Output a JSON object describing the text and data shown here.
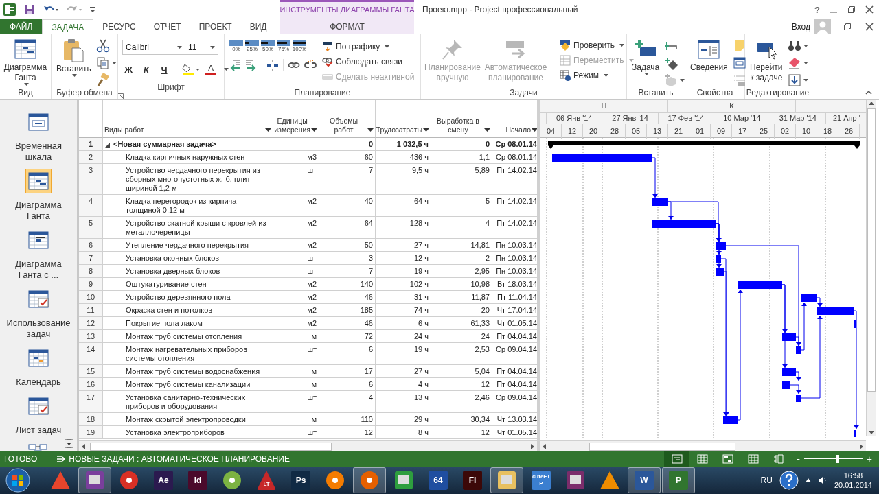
{
  "title_bar": {
    "title": "Проект.mpp - Project профессиональный",
    "context_label": "ИНСТРУМЕНТЫ ДИАГРАММЫ ГАНТА",
    "help": "?"
  },
  "tabs": [
    {
      "label": "ФАЙЛ",
      "kind": "file",
      "selected": false
    },
    {
      "label": "ЗАДАЧА",
      "kind": "tab",
      "selected": true
    },
    {
      "label": "РЕСУРС",
      "kind": "tab",
      "selected": false
    },
    {
      "label": "ОТЧЕТ",
      "kind": "tab",
      "selected": false
    },
    {
      "label": "ПРОЕКТ",
      "kind": "tab",
      "selected": false
    },
    {
      "label": "ВИД",
      "kind": "tab",
      "selected": false
    },
    {
      "label": "ФОРМАТ",
      "kind": "context",
      "selected": false
    }
  ],
  "account": {
    "label": "Вход"
  },
  "ribbon": {
    "view": {
      "label": "Вид",
      "button": {
        "label": "Диаграмма Ганта",
        "menu": true
      }
    },
    "clipboard": {
      "label": "Буфер обмена",
      "paste": {
        "label": "Вставить",
        "menu": true
      }
    },
    "font": {
      "label": "Шрифт",
      "family": "Calibri",
      "size": "11",
      "bold": "Ж",
      "italic": "К",
      "underline": "Ч",
      "font_color": "А"
    },
    "schedule": {
      "label": "Планирование",
      "percents": [
        "0%",
        "25%",
        "50%",
        "75%",
        "100%"
      ],
      "commands": [
        {
          "label": "По графику",
          "menu": true,
          "disabled": false
        },
        {
          "label": "Соблюдать связи",
          "menu": false,
          "disabled": false
        },
        {
          "label": "Сделать неактивной",
          "menu": false,
          "disabled": true
        }
      ]
    },
    "tasks": {
      "label": "Задачи",
      "modes": [
        {
          "label": "Планирование вручную",
          "disabled": true
        },
        {
          "label": "Автоматическое планирование",
          "disabled": true
        }
      ],
      "commands": [
        {
          "label": "Проверить",
          "menu": true,
          "disabled": false
        },
        {
          "label": "Переместить",
          "menu": true,
          "disabled": true
        },
        {
          "label": "Режим",
          "menu": true,
          "disabled": false
        }
      ]
    },
    "insert": {
      "label": "Вставить",
      "button": {
        "label": "Задача",
        "menu": true
      }
    },
    "properties": {
      "label": "Свойства",
      "button": {
        "label": "Сведения"
      }
    },
    "editing": {
      "label": "Редактирование",
      "button": {
        "label": "Перейти к задаче"
      }
    }
  },
  "views": [
    {
      "label": "Временная шкала",
      "selected": false
    },
    {
      "label": "Диаграмма Ганта",
      "selected": true
    },
    {
      "label": "Диаграмма Ганта с ...",
      "selected": false
    },
    {
      "label": "Использование задач",
      "selected": false
    },
    {
      "label": "Календарь",
      "selected": false
    },
    {
      "label": "Лист задач",
      "selected": false
    }
  ],
  "table": {
    "columns": [
      "Виды работ",
      "Единицы измерения",
      "Объемы работ",
      "Трудозатраты",
      "Выработка в смену",
      "Начало"
    ],
    "rows": [
      {
        "id": "1",
        "name": "<Новая суммарная задача>",
        "volume": "0",
        "labor": "1 032,5 ч",
        "rate": "0",
        "start": "Ср 08.01.14",
        "expanded": true,
        "children": [
          {
            "id": "2",
            "name": "Кладка кирпичных наружных стен",
            "unit": "м3",
            "volume": "60",
            "labor": "436 ч",
            "rate": "1,1",
            "start": "Ср 08.01.14"
          },
          {
            "id": "3",
            "name": "Устройство чердачного перекрытия из сборных многопустотных ж.-б. плит шириной 1,2 м",
            "unit": "шт",
            "volume": "7",
            "labor": "9,5 ч",
            "rate": "5,89",
            "start": "Пт 14.02.14"
          },
          {
            "id": "4",
            "name": "Кладка перегородок из кирпича толщиной 0,12 м",
            "unit": "м2",
            "volume": "40",
            "labor": "64 ч",
            "rate": "5",
            "start": "Пт 14.02.14"
          },
          {
            "id": "5",
            "name": "Устройство скатной крыши с кровлей из металлочерепицы",
            "unit": "м2",
            "volume": "64",
            "labor": "128 ч",
            "rate": "4",
            "start": "Пт 14.02.14"
          },
          {
            "id": "6",
            "name": "Утепление чердачного перекрытия",
            "unit": "м2",
            "volume": "50",
            "labor": "27 ч",
            "rate": "14,81",
            "start": "Пн 10.03.14"
          },
          {
            "id": "7",
            "name": "Установка оконных блоков",
            "unit": "шт",
            "volume": "3",
            "labor": "12 ч",
            "rate": "2",
            "start": "Пн 10.03.14"
          },
          {
            "id": "8",
            "name": "Установка дверных блоков",
            "unit": "шт",
            "volume": "7",
            "labor": "19 ч",
            "rate": "2,95",
            "start": "Пн 10.03.14"
          },
          {
            "id": "9",
            "name": "Оштукатуривание стен",
            "unit": "м2",
            "volume": "140",
            "labor": "102 ч",
            "rate": "10,98",
            "start": "Вт 18.03.14"
          },
          {
            "id": "10",
            "name": "Устройство деревянного пола",
            "unit": "м2",
            "volume": "46",
            "labor": "31 ч",
            "rate": "11,87",
            "start": "Пт 11.04.14"
          },
          {
            "id": "11",
            "name": "Окраска стен и потолков",
            "unit": "м2",
            "volume": "185",
            "labor": "74 ч",
            "rate": "20",
            "start": "Чт 17.04.14"
          },
          {
            "id": "12",
            "name": "Покрытие пола лаком",
            "unit": "м2",
            "volume": "46",
            "labor": "6 ч",
            "rate": "61,33",
            "start": "Чт 01.05.14"
          },
          {
            "id": "13",
            "name": "Монтаж труб системы отопления",
            "unit": "м",
            "volume": "72",
            "labor": "24 ч",
            "rate": "24",
            "start": "Пт 04.04.14"
          },
          {
            "id": "14",
            "name": "Монтаж нагревательных приборов системы отопления",
            "unit": "шт",
            "volume": "6",
            "labor": "19 ч",
            "rate": "2,53",
            "start": "Ср 09.04.14"
          },
          {
            "id": "15",
            "name": "Монтаж труб системы водоснабжения",
            "unit": "м",
            "volume": "17",
            "labor": "27 ч",
            "rate": "5,04",
            "start": "Пт 04.04.14"
          },
          {
            "id": "16",
            "name": "Монтаж труб системы канализации",
            "unit": "м",
            "volume": "6",
            "labor": "4 ч",
            "rate": "12",
            "start": "Пт 04.04.14"
          },
          {
            "id": "17",
            "name": "Установка санитарно-технических приборов и оборудования",
            "unit": "шт",
            "volume": "4",
            "labor": "13 ч",
            "rate": "2,46",
            "start": "Ср 09.04.14"
          },
          {
            "id": "18",
            "name": "Монтаж скрытой электропроводки",
            "unit": "м",
            "volume": "110",
            "labor": "29 ч",
            "rate": "30,34",
            "start": "Чт 13.03.14"
          },
          {
            "id": "19",
            "name": "Установка электроприборов",
            "unit": "шт",
            "volume": "12",
            "labor": "8 ч",
            "rate": "12",
            "start": "Чт 01.05.14"
          }
        ]
      }
    ]
  },
  "timescale": {
    "tier_1": [
      "Н",
      "К"
    ],
    "tier_2": [
      "06 Янв '14",
      "27 Янв '14",
      "17 Фев '14",
      "10 Мар '14",
      "31 Мар '14",
      "21 Апр '"
    ],
    "tier_3": [
      "04",
      "12",
      "20",
      "28",
      "05",
      "13",
      "21",
      "01",
      "09",
      "17",
      "25",
      "02",
      "10",
      "18",
      "26"
    ]
  },
  "status_bar": {
    "ready": "ГОТОВО",
    "mode": "НОВЫЕ ЗАДАЧИ : АВТОМАТИЧЕСКОЕ ПЛАНИРОВАНИЕ",
    "view_buttons": [
      {
        "selected": true
      },
      {
        "selected": false
      },
      {
        "selected": false
      },
      {
        "selected": false
      },
      {
        "selected": false
      }
    ],
    "zoom_out": "-",
    "zoom_in": "+",
    "zoom": {
      "level": 0.58
    }
  },
  "taskbar": {
    "apps": [
      {
        "kind": "triangle",
        "color": "#e8452c",
        "active": false
      },
      {
        "kind": "tile",
        "color": "#7a3f9c",
        "active": true
      },
      {
        "kind": "circle",
        "color": "#d93025",
        "active": false
      },
      {
        "kind": "tile",
        "label": "Ae",
        "color": "#2b1a4f",
        "active": false
      },
      {
        "kind": "tile",
        "label": "Id",
        "color": "#4b0a2b",
        "active": false
      },
      {
        "kind": "circle",
        "color": "#7cb342",
        "active": false
      },
      {
        "kind": "triangle",
        "label": "LT",
        "color": "#c62828",
        "active": false
      },
      {
        "kind": "tile",
        "label": "Ps",
        "color": "#102a44",
        "active": false
      },
      {
        "kind": "circle",
        "color": "#f57c00",
        "active": false
      },
      {
        "kind": "circle",
        "color": "#e66000",
        "active": true
      },
      {
        "kind": "tile",
        "color": "#2e9e3e",
        "active": false
      },
      {
        "kind": "tile",
        "label": "64",
        "color": "#1f4ea0",
        "active": false
      },
      {
        "kind": "tile",
        "label": "Fl",
        "color": "#3c0808",
        "active": false
      },
      {
        "kind": "tile",
        "color": "#e8c060",
        "active": true
      },
      {
        "kind": "tile",
        "label": "cuteFTP",
        "color": "#3b7fd0",
        "active": false
      },
      {
        "kind": "tile",
        "color": "#7b2d6b",
        "active": false
      },
      {
        "kind": "triangle",
        "color": "#f08c00",
        "active": false
      },
      {
        "kind": "tile",
        "label": "W",
        "color": "#2b579a",
        "active": true
      },
      {
        "kind": "tile",
        "label": "P",
        "color": "#31752f",
        "active": true
      }
    ],
    "language": "RU",
    "time": "16:58",
    "date": "20.01.2014"
  }
}
